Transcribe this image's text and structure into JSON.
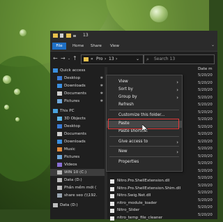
{
  "window": {
    "title": "13"
  },
  "ribbon": {
    "file_tab": "File",
    "tabs": [
      "Home",
      "Share",
      "View"
    ],
    "collapse_glyph": "⌄"
  },
  "address_bar": {
    "crumb_prefix": "«",
    "crumbs": [
      "Pro",
      "13"
    ],
    "separator": "›",
    "dropdown_glyph": "⌄",
    "search_placeholder": "Search 13"
  },
  "nav_pane": {
    "items": [
      {
        "label": "Quick access",
        "icon": "star-icon",
        "pinned": false,
        "selected": false
      },
      {
        "label": "Desktop",
        "icon": "desktop-icon",
        "pinned": true,
        "selected": false
      },
      {
        "label": "Downloads",
        "icon": "downloads-icon",
        "pinned": true,
        "selected": false
      },
      {
        "label": "Documents",
        "icon": "documents-icon",
        "pinned": true,
        "selected": false
      },
      {
        "label": "Pictures",
        "icon": "pictures-icon",
        "pinned": true,
        "selected": false
      },
      {
        "label": "This PC",
        "icon": "pc-icon",
        "pinned": false,
        "selected": false
      },
      {
        "label": "3D Objects",
        "icon": "cube-icon",
        "pinned": false,
        "selected": false
      },
      {
        "label": "Desktop",
        "icon": "desktop-icon",
        "pinned": false,
        "selected": false
      },
      {
        "label": "Documents",
        "icon": "documents-icon",
        "pinned": false,
        "selected": false
      },
      {
        "label": "Downloads",
        "icon": "downloads-icon",
        "pinned": false,
        "selected": false
      },
      {
        "label": "Music",
        "icon": "music-icon",
        "pinned": false,
        "selected": false
      },
      {
        "label": "Pictures",
        "icon": "pictures-icon",
        "pinned": false,
        "selected": false
      },
      {
        "label": "Videos",
        "icon": "videos-icon",
        "pinned": false,
        "selected": false
      },
      {
        "label": "WIN 10 (C:)",
        "icon": "drive-icon",
        "pinned": false,
        "selected": true
      },
      {
        "label": "Data (D:)",
        "icon": "drive-icon",
        "pinned": false,
        "selected": false
      },
      {
        "label": "Phần mềm mới (",
        "icon": "drive-icon",
        "pinned": false,
        "selected": false
      },
      {
        "label": "share seo (\\\\192.",
        "icon": "network-drive-icon",
        "pinned": false,
        "selected": false
      },
      {
        "label": "Data (D:)",
        "icon": "drive-icon",
        "pinned": false,
        "selected": false
      }
    ],
    "pin_glyph": "✱"
  },
  "file_list": {
    "date_header": "Date m",
    "dates": [
      "5/20/20",
      "5/20/20",
      "5/20/20",
      "5/20/20",
      "5/20/20",
      "5/20/20",
      "5/20/20",
      "5/20/20",
      "5/20/20",
      "5/20/20",
      "5/20/20",
      "5/20/20",
      "5/20/20",
      "5/20/20",
      "5/20/20",
      "5/20/20",
      "5/20/20",
      "5/20/20",
      "5/20/20",
      "5/20/20"
    ],
    "files": [
      {
        "label": "Nitro.Pro.ShellExtension.dll"
      },
      {
        "label": "Nitro.Pro.ShellExtension.Shim.dll"
      },
      {
        "label": "Nitro.Swig.Net.dll"
      },
      {
        "label": "nitro_module_loader"
      },
      {
        "label": "Nitro_Slider"
      },
      {
        "label": "nitro_temp_file_cleaner"
      }
    ]
  },
  "context_menu": {
    "items": [
      {
        "label": "View",
        "submenu": true
      },
      {
        "label": "Sort by",
        "submenu": true
      },
      {
        "label": "Group by",
        "submenu": true
      },
      {
        "label": "Refresh",
        "submenu": false
      },
      {
        "label": "Customize this folder...",
        "submenu": false
      },
      {
        "label": "Paste",
        "submenu": false,
        "highlighted": true
      },
      {
        "label": "Paste shortcut",
        "submenu": false
      },
      {
        "label": "Give access to",
        "submenu": true
      },
      {
        "label": "New",
        "submenu": true
      },
      {
        "label": "Properties",
        "submenu": false
      }
    ],
    "submenu_glyph": "›"
  },
  "colors": {
    "accent": "#1f6fc4",
    "highlight_box": "#e23b3b",
    "folder": "#e8c04c"
  }
}
